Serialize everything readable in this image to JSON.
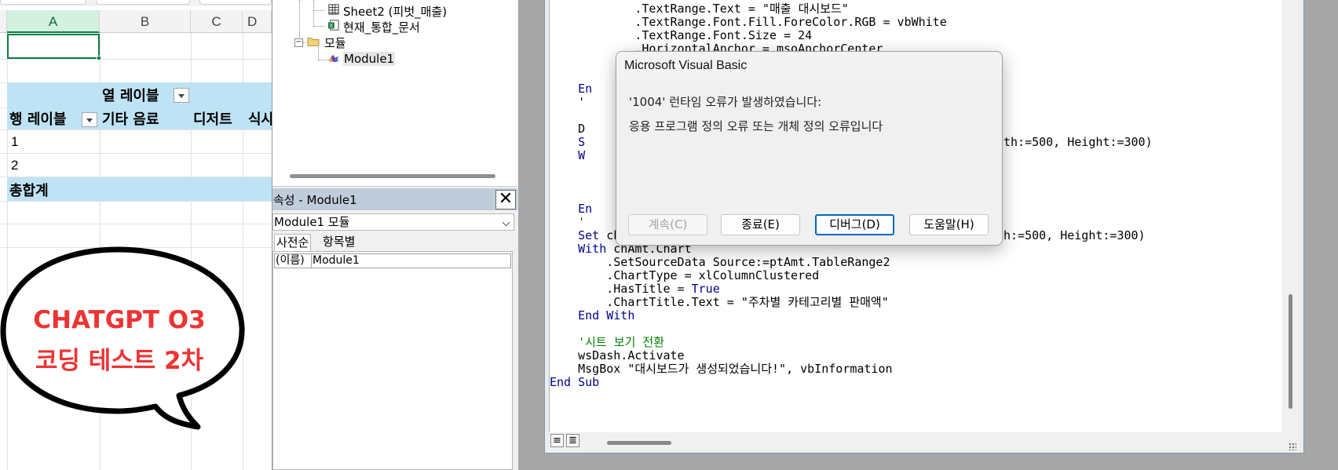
{
  "excel": {
    "columns": [
      "A",
      "B",
      "C",
      "D"
    ],
    "pivot": {
      "col_label": "열 레이블",
      "row_label": "행 레이블",
      "headers": [
        "기타 음료",
        "디저트",
        "식사"
      ],
      "rows": [
        "1",
        "2"
      ],
      "grand_total": "총합계"
    },
    "bubble": {
      "line1": "CHATGPT O3",
      "line2": "코딩 테스트 2차",
      "color": "#ee3333"
    }
  },
  "project": {
    "items": [
      {
        "label": "Sheet2 (피벗_매출)",
        "icon": "sheet-icon"
      },
      {
        "label": "현재_통합_문서",
        "icon": "workbook-icon"
      },
      {
        "label": "모듈",
        "icon": "folder-icon"
      },
      {
        "label": "Module1",
        "icon": "module-icon"
      }
    ]
  },
  "properties": {
    "title": "속성 - Module1",
    "close_glyph": "✕",
    "combo_value": "Module1 모듈",
    "tabs": [
      "사전순",
      "항목별"
    ],
    "row_key": "(이름)",
    "row_value": "Module1"
  },
  "code": {
    "lines": [
      [
        {
          "t": "            .TextRange.Text = \"매출 대시보드\""
        }
      ],
      [
        {
          "t": "            .TextRange.Font.Fill.ForeColor.RGB = vbWhite"
        }
      ],
      [
        {
          "t": "            .TextRange.Font.Size = 24"
        }
      ],
      [
        {
          "t": "            .HorizontalAnchor = msoAnchorCenter"
        }
      ],
      [
        {
          "t": ""
        }
      ],
      [
        {
          "t": ""
        }
      ],
      [
        {
          "t": "    "
        },
        {
          "t": "En",
          "c": "kw"
        }
      ],
      [
        {
          "t": "    '"
        }
      ],
      [
        {
          "t": ""
        }
      ],
      [
        {
          "t": "    D"
        }
      ],
      [
        {
          "t": "    S",
          "c": "kw"
        },
        {
          "t": "                                                          dth:=500, Height:=300)"
        }
      ],
      [
        {
          "t": "    W",
          "c": "kw"
        }
      ],
      [
        {
          "t": ""
        }
      ],
      [
        {
          "t": ""
        }
      ],
      [
        {
          "t": ""
        }
      ],
      [
        {
          "t": "    "
        },
        {
          "t": "En",
          "c": "kw"
        }
      ],
      [
        {
          "t": "    '",
          "c": "cm"
        }
      ],
      [
        {
          "t": "    "
        },
        {
          "t": "Set",
          "c": "kw"
        },
        {
          "t": " chAmt = wsDash.ChartObjects.Add(Left:=560, Top:=90, Width:=500, Height:=300)"
        }
      ],
      [
        {
          "t": "    "
        },
        {
          "t": "With",
          "c": "kw"
        },
        {
          "t": " chAmt.Chart"
        }
      ],
      [
        {
          "t": "        .SetSourceData Source:=ptAmt.TableRange2"
        }
      ],
      [
        {
          "t": "        .ChartType = xlColumnClustered"
        }
      ],
      [
        {
          "t": "        .HasTitle = "
        },
        {
          "t": "True",
          "c": "kw"
        }
      ],
      [
        {
          "t": "        .ChartTitle.Text = \"주차별 카테고리별 판매액\""
        }
      ],
      [
        {
          "t": "    "
        },
        {
          "t": "End With",
          "c": "kw"
        }
      ],
      [
        {
          "t": ""
        }
      ],
      [
        {
          "t": "    '시트 보기 전환",
          "c": "cm"
        }
      ],
      [
        {
          "t": "    wsDash.Activate"
        }
      ],
      [
        {
          "t": "    MsgBox \"대시보드가 생성되었습니다!\", vbInformation"
        }
      ],
      [
        {
          "t": "End Sub",
          "c": "kw"
        }
      ]
    ]
  },
  "dialog": {
    "title": "Microsoft Visual Basic",
    "error_line": "'1004' 런타임 오류가 발생하였습니다:",
    "message": "응용 프로그램 정의 오류 또는 개체 정의 오류입니다",
    "buttons": {
      "continue": "계속(C)",
      "end": "종료(E)",
      "debug": "디버그(D)",
      "help": "도움말(H)"
    },
    "accent": "#0067c0"
  }
}
